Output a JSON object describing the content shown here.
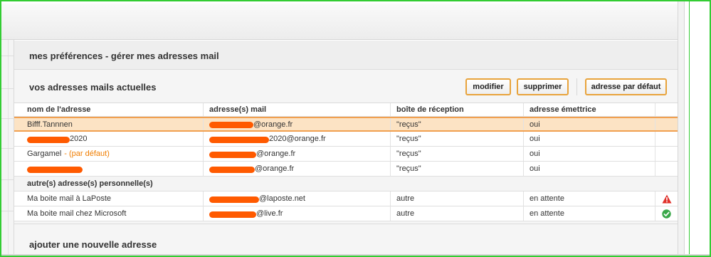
{
  "page": {
    "title": "mes préférences - gérer mes adresses mail",
    "section_title": "vos adresses mails actuelles",
    "add_section_title": "ajouter une nouvelle adresse"
  },
  "toolbar": {
    "modify_label": "modifier",
    "delete_label": "supprimer",
    "default_label": "adresse par défaut"
  },
  "table": {
    "headers": [
      "nom de l'adresse",
      "adresse(s) mail",
      "boîte de réception",
      "adresse émettrice"
    ],
    "rows": [
      {
        "name": "Bifff.Tannnen",
        "name_suffix": "",
        "mail_domain": "@orange.fr",
        "inbox": "\"reçus\"",
        "sender": "oui",
        "selected": true
      },
      {
        "name": "2020",
        "name_suffix": "",
        "mail_domain": "2020@orange.fr",
        "inbox": "\"reçus\"",
        "sender": "oui"
      },
      {
        "name": "Gargamel",
        "name_suffix": "- (par défaut)",
        "mail_domain": "@orange.fr",
        "inbox": "\"reçus\"",
        "sender": "oui"
      },
      {
        "name": "",
        "name_suffix": "",
        "mail_domain": "@orange.fr",
        "inbox": "\"reçus\"",
        "sender": "oui"
      }
    ],
    "group_label": "autre(s) adresse(s) personnelle(s)",
    "other_rows": [
      {
        "name": "Ma boite mail à LaPoste",
        "mail_domain": "@laposte.net",
        "inbox": "autre",
        "sender": "en attente",
        "status_icon": "warning-icon",
        "status_color": "#e0302a"
      },
      {
        "name": "Ma boite mail chez Microsoft",
        "mail_domain": "@live.fr",
        "inbox": "autre",
        "sender": "en attente",
        "status_icon": "check-circle-icon",
        "status_color": "#3aa84a"
      }
    ]
  },
  "colors": {
    "accent": "#f07d00",
    "button_border": "#e8a33b",
    "selected_row": "#fce3c4",
    "redaction": "#ff5a00",
    "frame": "#33cc33"
  }
}
